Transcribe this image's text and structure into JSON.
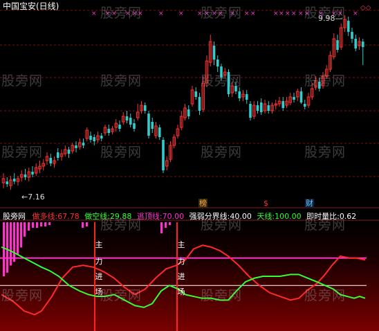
{
  "title": "中国宝安(日线)",
  "price_labels": {
    "high": "9.98",
    "low": "7.16"
  },
  "top_markers": [
    "×",
    "◇◇"
  ],
  "watermark": "股旁网",
  "indicator": {
    "name": "股旁网",
    "items": [
      {
        "label": "做多线:",
        "value": "67.78",
        "color": "#ff3333"
      },
      {
        "label": "做空线:",
        "value": "29.88",
        "color": "#33ff33"
      },
      {
        "label": "逃顶线:",
        "value": "70.00",
        "color": "#ff33cc"
      },
      {
        "label": "强弱分界线:",
        "value": "40.00",
        "color": "#ffffff"
      },
      {
        "label": "天线:",
        "value": "100.00",
        "color": "#33ff33"
      },
      {
        "label": "即时量比:",
        "value": "0.62",
        "color": "#ffffff"
      }
    ]
  },
  "entry_signal": [
    "主",
    "力",
    "进",
    "场"
  ],
  "tags": {
    "bang": "榜",
    "dollar": "$",
    "cai": "财"
  },
  "colors": {
    "up": "#ff3333",
    "down": "#33cccc",
    "pink": "#ff33cc",
    "green": "#33ff33"
  }
}
